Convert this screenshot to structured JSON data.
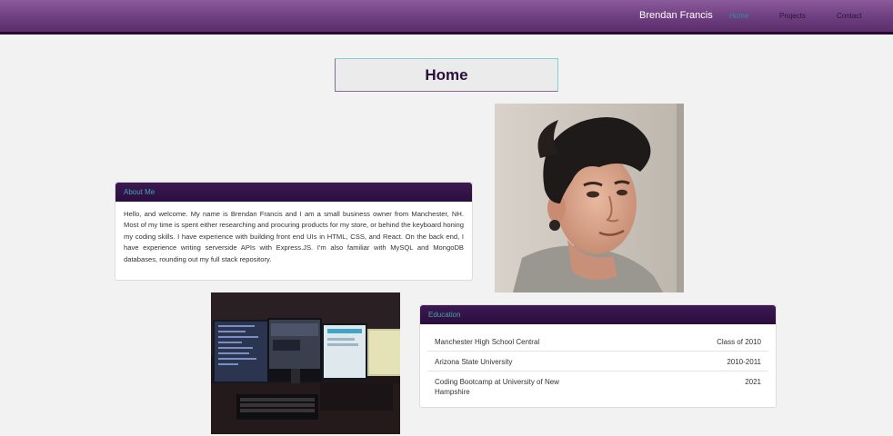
{
  "nav": {
    "brand": "Brendan Francis",
    "links": [
      {
        "label": "Home",
        "active": true
      },
      {
        "label": "Projects",
        "active": false
      },
      {
        "label": "Contact",
        "active": false
      }
    ]
  },
  "page": {
    "title": "Home"
  },
  "about": {
    "heading": "About Me",
    "text": "Hello, and welcome. My name is Brendan Francis and I am a small business owner from Manchester, NH. Most of my time is spent either researching and procuring products for my store, or behind the keyboard honing my coding skills. I have experience with building front end UIs in HTML, CSS, and React. On the back end, I have experience writing serverside APIs with Express.JS. I'm also familiar with MySQL and MongoDB databases, rounding out my full stack repository."
  },
  "education": {
    "heading": "Education",
    "rows": [
      {
        "school": "Manchester High School Central",
        "year": "Class of 2010"
      },
      {
        "school": "Arizona State University",
        "year": "2010-2011"
      },
      {
        "school": "Coding Bootcamp at University of New Hampshire",
        "year": "2021"
      }
    ]
  },
  "colors": {
    "navbar": "#6e3f80",
    "card_header": "#2b0d3e",
    "accent_teal": "#3fa6b0",
    "background": "#f2f2f2"
  }
}
